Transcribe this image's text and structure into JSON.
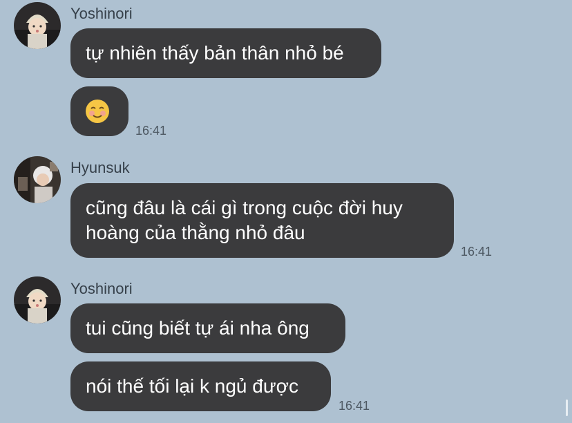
{
  "messages": [
    {
      "sender": "Yoshinori",
      "bubbles": [
        {
          "lines": [
            "tự nhiên thấy bản thân nhỏ bé"
          ]
        },
        {
          "lines": [
            "☺️"
          ]
        }
      ],
      "time": "16:41"
    },
    {
      "sender": "Hyunsuk",
      "bubbles": [
        {
          "lines": [
            "cũng đâu là cái gì trong cuộc đời huy",
            "hoàng của thằng nhỏ đâu"
          ]
        }
      ],
      "time": "16:41"
    },
    {
      "sender": "Yoshinori",
      "bubbles": [
        {
          "lines": [
            "tui cũng biết tự ái nha ông"
          ]
        },
        {
          "lines": [
            "nói thế tối lại k ngủ được"
          ]
        }
      ],
      "time": "16:41"
    }
  ],
  "colors": {
    "background": "#aec1d1",
    "bubble": "#3b3b3d",
    "bubble_text": "#ffffff"
  }
}
